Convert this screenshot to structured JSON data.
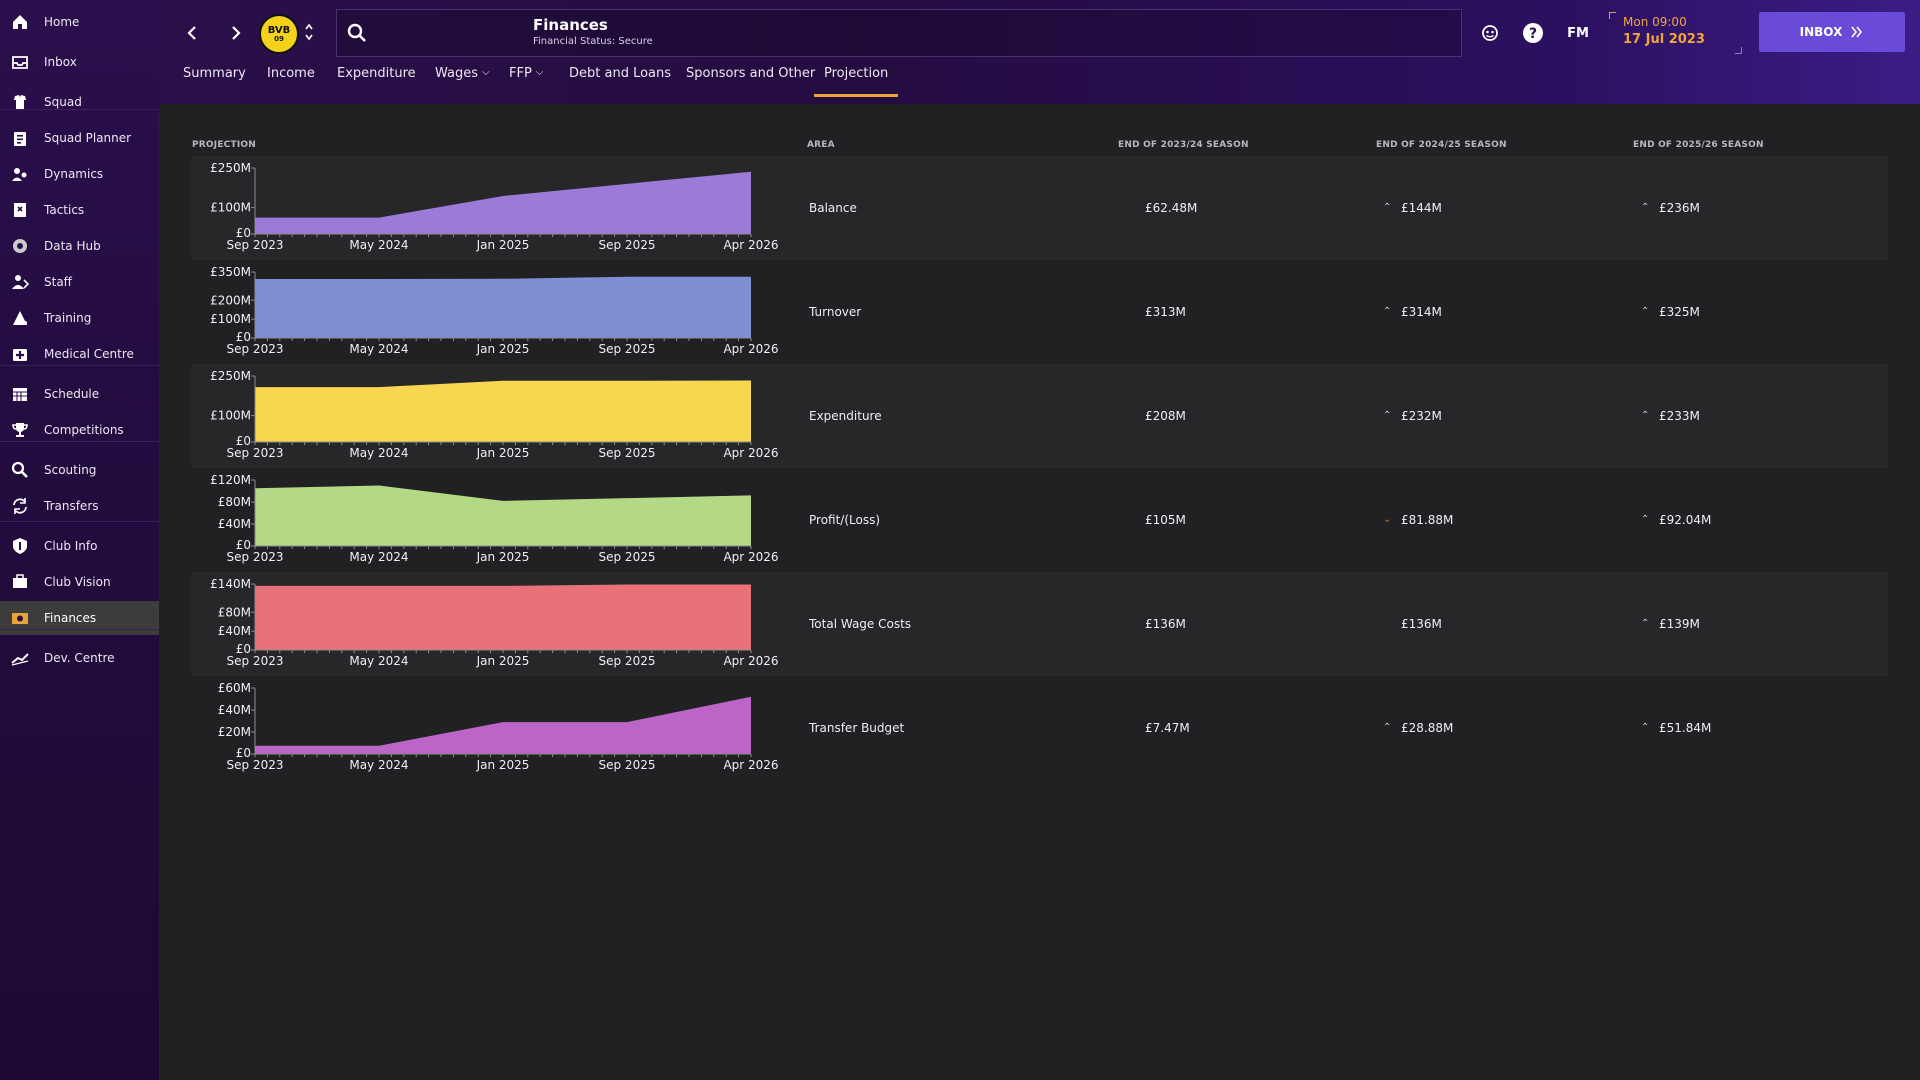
{
  "sidebar": {
    "items": [
      {
        "label": "Home",
        "icon": "home-icon"
      },
      {
        "label": "Inbox",
        "icon": "inbox-icon"
      },
      {
        "label": "Squad",
        "icon": "squad-icon"
      },
      {
        "label": "Squad Planner",
        "icon": "clipboard-icon"
      },
      {
        "label": "Dynamics",
        "icon": "dynamics-icon"
      },
      {
        "label": "Tactics",
        "icon": "tactics-icon"
      },
      {
        "label": "Data Hub",
        "icon": "data-hub-icon"
      },
      {
        "label": "Staff",
        "icon": "staff-icon"
      },
      {
        "label": "Training",
        "icon": "training-icon"
      },
      {
        "label": "Medical Centre",
        "icon": "medical-icon"
      },
      {
        "label": "Schedule",
        "icon": "calendar-icon"
      },
      {
        "label": "Competitions",
        "icon": "trophy-icon"
      },
      {
        "label": "Scouting",
        "icon": "scouting-icon"
      },
      {
        "label": "Transfers",
        "icon": "transfers-icon"
      },
      {
        "label": "Club Info",
        "icon": "shield-icon"
      },
      {
        "label": "Club Vision",
        "icon": "vision-icon"
      },
      {
        "label": "Finances",
        "icon": "finances-icon",
        "active": true
      },
      {
        "label": "Dev. Centre",
        "icon": "dev-centre-icon"
      }
    ]
  },
  "header": {
    "title": "Finances",
    "subtitle": "Financial Status: Secure",
    "club_badge": "BVB",
    "club_badge_year": "09",
    "fm_label": "FM",
    "date_time": "Mon 09:00",
    "date_day": "17 Jul 2023",
    "inbox_label": "INBOX",
    "tabs": [
      {
        "label": "Summary"
      },
      {
        "label": "Income"
      },
      {
        "label": "Expenditure"
      },
      {
        "label": "Wages",
        "dropdown": true
      },
      {
        "label": "FFP",
        "dropdown": true
      },
      {
        "label": "Debt and Loans"
      },
      {
        "label": "Sponsors and Other"
      },
      {
        "label": "Projection",
        "active": true
      }
    ],
    "accent": "#e8a43a",
    "inbox_color": "#6a4ad8"
  },
  "table": {
    "headers": {
      "projection": "PROJECTION",
      "area": "AREA",
      "s1": "END OF 2023/24 SEASON",
      "s2": "END OF 2024/25 SEASON",
      "s3": "END OF 2025/26 SEASON"
    },
    "rows": [
      {
        "area": "Balance",
        "s1": "£62.48M",
        "s2": "£144M",
        "s2_trend": "up",
        "s3": "£236M",
        "s3_trend": "up"
      },
      {
        "area": "Turnover",
        "s1": "£313M",
        "s2": "£314M",
        "s2_trend": "up",
        "s3": "£325M",
        "s3_trend": "up"
      },
      {
        "area": "Expenditure",
        "s1": "£208M",
        "s2": "£232M",
        "s2_trend": "up",
        "s3": "£233M",
        "s3_trend": "up"
      },
      {
        "area": "Profit/(Loss)",
        "s1": "£105M",
        "s2": "£81.88M",
        "s2_trend": "down",
        "s3": "£92.04M",
        "s3_trend": "up"
      },
      {
        "area": "Total Wage Costs",
        "s1": "£136M",
        "s2": "£136M",
        "s2_trend": "none",
        "s3": "£139M",
        "s3_trend": "up"
      },
      {
        "area": "Transfer Budget",
        "s1": "£7.47M",
        "s2": "£28.88M",
        "s2_trend": "up",
        "s3": "£51.84M",
        "s3_trend": "up"
      }
    ]
  },
  "chart_data": [
    {
      "type": "area",
      "color": "#9c7ad8",
      "x": [
        "Sep 2023",
        "May 2024",
        "Jan 2025",
        "Sep 2025",
        "Apr 2026"
      ],
      "x_tick_labels": [
        "Sep 2023",
        "May 2024",
        "Jan 2025",
        "Sep 2025",
        "Apr 2026"
      ],
      "y_tick_labels": [
        "£250M",
        "£100M",
        "£0"
      ],
      "y_ticks": [
        250,
        100,
        0
      ],
      "ylim": [
        0,
        250
      ],
      "values": [
        62,
        62,
        144,
        190,
        236
      ]
    },
    {
      "type": "area",
      "color": "#7f8fd3",
      "x": [
        "Sep 2023",
        "May 2024",
        "Jan 2025",
        "Sep 2025",
        "Apr 2026"
      ],
      "x_tick_labels": [
        "Sep 2023",
        "May 2024",
        "Jan 2025",
        "Sep 2025",
        "Apr 2026"
      ],
      "y_tick_labels": [
        "£350M",
        "£200M",
        "£100M",
        "£0"
      ],
      "y_ticks": [
        350,
        200,
        100,
        0
      ],
      "ylim": [
        0,
        350
      ],
      "values": [
        313,
        313,
        314,
        325,
        325
      ]
    },
    {
      "type": "area",
      "color": "#f9d64f",
      "x": [
        "Sep 2023",
        "May 2024",
        "Jan 2025",
        "Sep 2025",
        "Apr 2026"
      ],
      "x_tick_labels": [
        "Sep 2023",
        "May 2024",
        "Jan 2025",
        "Sep 2025",
        "Apr 2026"
      ],
      "y_tick_labels": [
        "£250M",
        "£100M",
        "£0"
      ],
      "y_ticks": [
        250,
        100,
        0
      ],
      "ylim": [
        0,
        250
      ],
      "values": [
        208,
        208,
        232,
        232,
        233
      ]
    },
    {
      "type": "area",
      "color": "#b3d987",
      "x": [
        "Sep 2023",
        "May 2024",
        "Jan 2025",
        "Sep 2025",
        "Apr 2026"
      ],
      "x_tick_labels": [
        "Sep 2023",
        "May 2024",
        "Jan 2025",
        "Sep 2025",
        "Apr 2026"
      ],
      "y_tick_labels": [
        "£120M",
        "£80M",
        "£40M",
        "£0"
      ],
      "y_ticks": [
        120,
        80,
        40,
        0
      ],
      "ylim": [
        0,
        120
      ],
      "values": [
        105,
        110,
        82,
        87,
        92
      ]
    },
    {
      "type": "area",
      "color": "#e9727a",
      "x": [
        "Sep 2023",
        "May 2024",
        "Jan 2025",
        "Sep 2025",
        "Apr 2026"
      ],
      "x_tick_labels": [
        "Sep 2023",
        "May 2024",
        "Jan 2025",
        "Sep 2025",
        "Apr 2026"
      ],
      "y_tick_labels": [
        "£140M",
        "£80M",
        "£40M",
        "£0"
      ],
      "y_ticks": [
        140,
        80,
        40,
        0
      ],
      "ylim": [
        0,
        140
      ],
      "values": [
        136,
        136,
        136,
        139,
        139
      ]
    },
    {
      "type": "area",
      "color": "#bb66c6",
      "x": [
        "Sep 2023",
        "May 2024",
        "Jan 2025",
        "Sep 2025",
        "Apr 2026"
      ],
      "x_tick_labels": [
        "Sep 2023",
        "May 2024",
        "Jan 2025",
        "Sep 2025",
        "Apr 2026"
      ],
      "y_tick_labels": [
        "£60M",
        "£40M",
        "£20M",
        "£0"
      ],
      "y_ticks": [
        60,
        40,
        20,
        0
      ],
      "ylim": [
        0,
        60
      ],
      "values": [
        7.5,
        7.5,
        29,
        29,
        52
      ]
    }
  ]
}
